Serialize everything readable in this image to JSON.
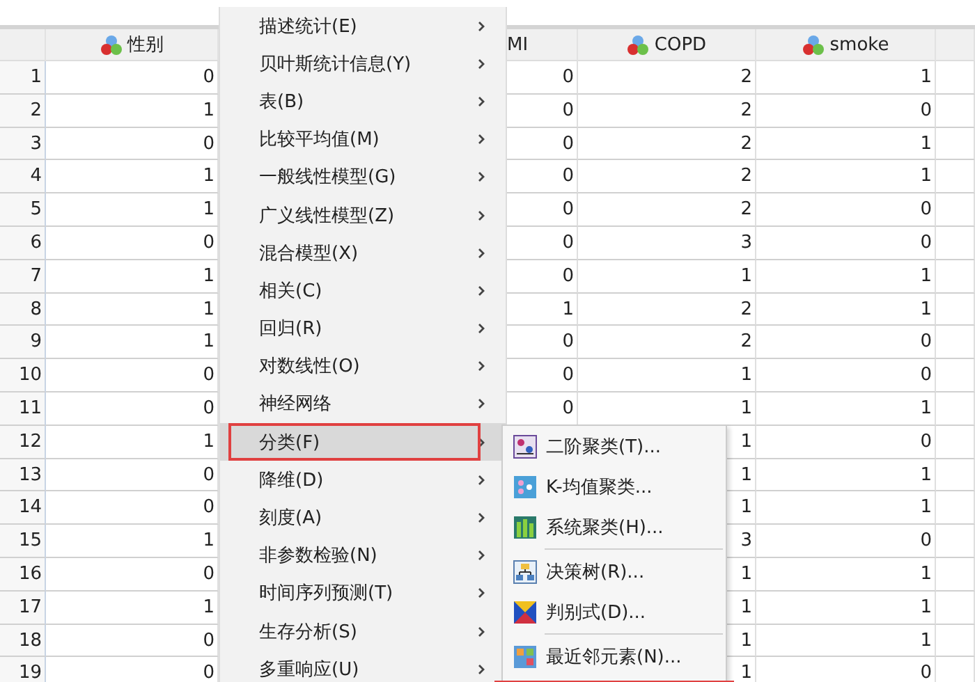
{
  "table": {
    "columns": [
      {
        "icon": false
      },
      {
        "label": "性别",
        "icon": true
      },
      {
        "label": "MI",
        "icon": false
      },
      {
        "label": "COPD",
        "icon": true
      },
      {
        "label": "smoke",
        "icon": true
      },
      {
        "icon": false
      }
    ],
    "rows": [
      [
        "1",
        "0",
        "0",
        "2",
        "1"
      ],
      [
        "2",
        "1",
        "0",
        "2",
        "0"
      ],
      [
        "3",
        "0",
        "0",
        "2",
        "1"
      ],
      [
        "4",
        "1",
        "0",
        "2",
        "1"
      ],
      [
        "5",
        "1",
        "0",
        "2",
        "0"
      ],
      [
        "6",
        "0",
        "0",
        "3",
        "0"
      ],
      [
        "7",
        "1",
        "0",
        "1",
        "1"
      ],
      [
        "8",
        "1",
        "1",
        "2",
        "1"
      ],
      [
        "9",
        "1",
        "0",
        "2",
        "0"
      ],
      [
        "10",
        "0",
        "0",
        "1",
        "0"
      ],
      [
        "11",
        "0",
        "0",
        "1",
        "1"
      ],
      [
        "12",
        "1",
        null,
        "1",
        "0"
      ],
      [
        "13",
        "0",
        null,
        "1",
        "1"
      ],
      [
        "14",
        "0",
        null,
        "1",
        "1"
      ],
      [
        "15",
        "1",
        null,
        "3",
        "0"
      ],
      [
        "16",
        "0",
        null,
        "1",
        "1"
      ],
      [
        "17",
        "1",
        null,
        "1",
        "1"
      ],
      [
        "18",
        "0",
        null,
        "1",
        "1"
      ],
      [
        "19",
        "0",
        null,
        "1",
        "0"
      ]
    ]
  },
  "menu": {
    "items": [
      {
        "text": "描述统计(E)",
        "selected": false
      },
      {
        "text": "贝叶斯统计信息(Y)",
        "selected": false
      },
      {
        "text": "表(B)",
        "selected": false
      },
      {
        "text": "比较平均值(M)",
        "selected": false
      },
      {
        "text": "一般线性模型(G)",
        "selected": false
      },
      {
        "text": "广义线性模型(Z)",
        "selected": false
      },
      {
        "text": "混合模型(X)",
        "selected": false
      },
      {
        "text": "相关(C)",
        "selected": false
      },
      {
        "text": "回归(R)",
        "selected": false
      },
      {
        "text": "对数线性(O)",
        "selected": false
      },
      {
        "text": "神经网络",
        "selected": false
      },
      {
        "text": "分类(F)",
        "selected": true
      },
      {
        "text": "降维(D)",
        "selected": false
      },
      {
        "text": "刻度(A)",
        "selected": false
      },
      {
        "text": "非参数检验(N)",
        "selected": false
      },
      {
        "text": "时间序列预测(T)",
        "selected": false
      },
      {
        "text": "生存分析(S)",
        "selected": false
      },
      {
        "text": "多重响应(U)",
        "selected": false
      }
    ]
  },
  "submenu": {
    "groups": [
      [
        {
          "text": "二阶聚类(T)...",
          "kind": "twostep"
        },
        {
          "text": "K-均值聚类...",
          "kind": "kmeans"
        },
        {
          "text": "系统聚类(H)...",
          "kind": "hier"
        }
      ],
      [
        {
          "text": "决策树(R)...",
          "kind": "tree"
        },
        {
          "text": "判别式(D)...",
          "kind": "discrim"
        }
      ],
      [
        {
          "text": "最近邻元素(N)...",
          "kind": "nn"
        }
      ]
    ]
  }
}
